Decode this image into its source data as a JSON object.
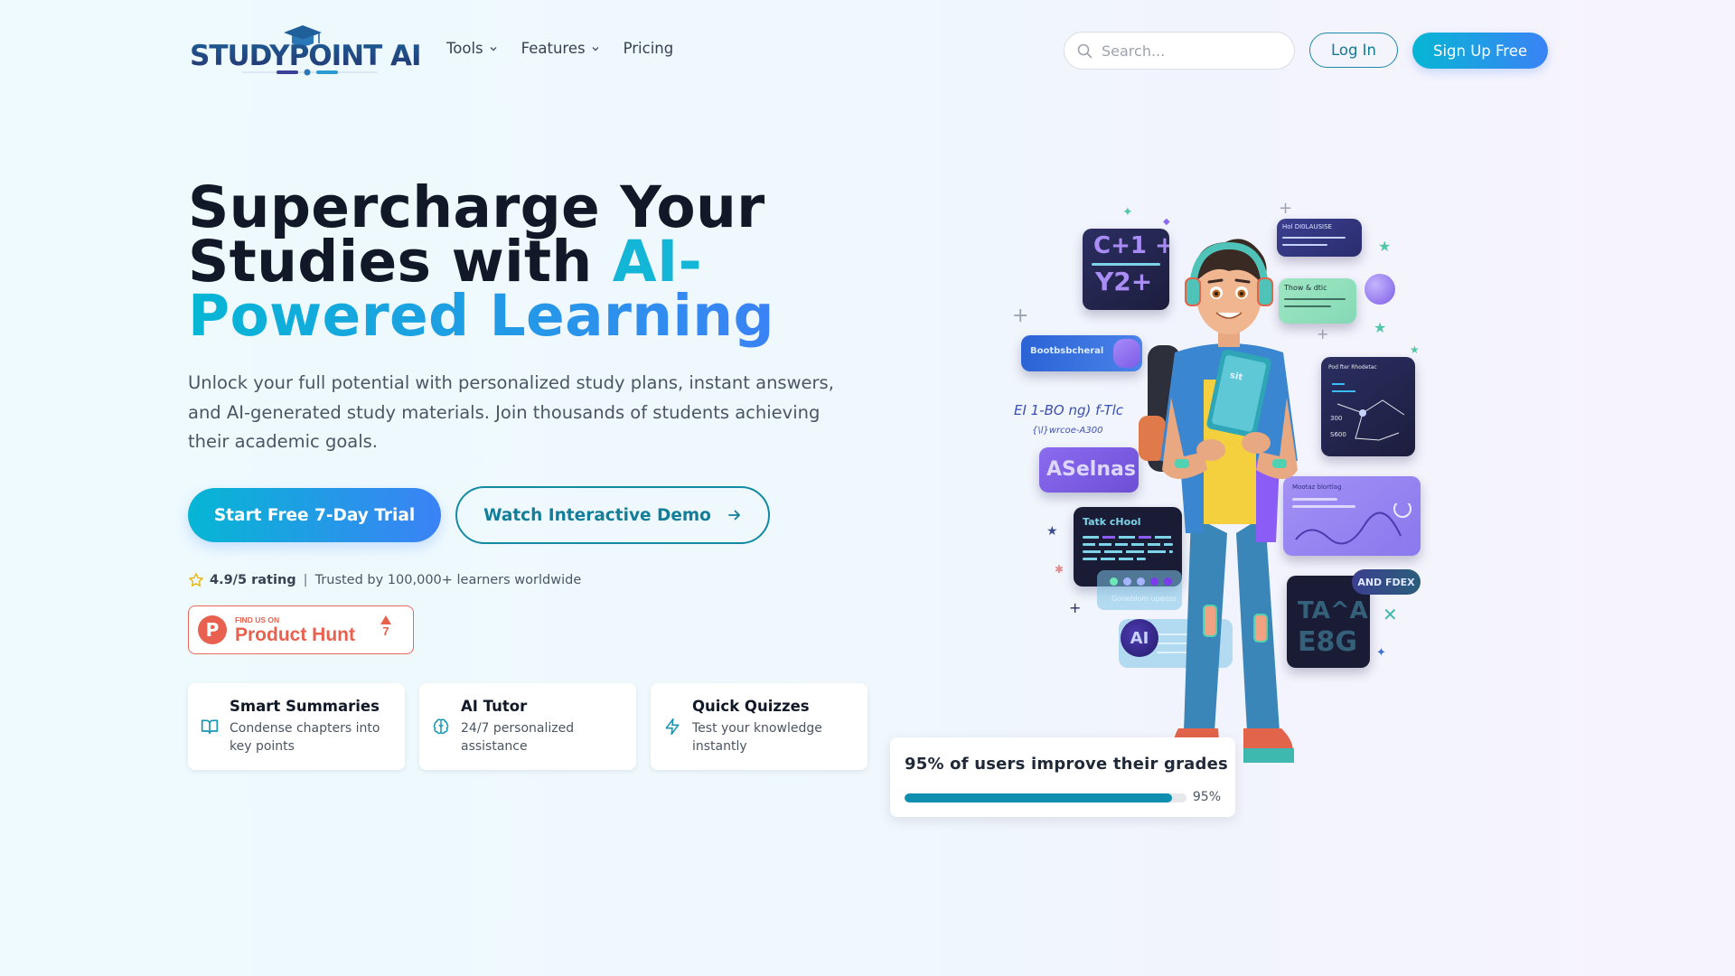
{
  "brand": {
    "name": "STUDYPOINT AI",
    "primary_gradient": [
      "#06b6d4",
      "#3b82f6"
    ],
    "text_dark": "#111827",
    "product_hunt_color": "#e8604f"
  },
  "header": {
    "logo_text": "STUDYPOINT AI",
    "nav": [
      {
        "label": "Tools",
        "has_dropdown": true
      },
      {
        "label": "Features",
        "has_dropdown": true
      },
      {
        "label": "Pricing",
        "has_dropdown": false
      }
    ],
    "search": {
      "placeholder": "Search...",
      "value": "",
      "icon": "search-icon"
    },
    "login_label": "Log In",
    "signup_label": "Sign Up Free"
  },
  "hero": {
    "headline_line1": "Supercharge Your",
    "headline_line2_plain": "Studies with ",
    "headline_line2_accent": "AI-",
    "headline_line3_accent": "Powered Learning",
    "lead": "Unlock your full potential with personalized study plans, instant answers, and AI-generated study materials. Join thousands of students achieving their academic goals.",
    "primary_cta": "Start Free 7-Day Trial",
    "secondary_cta": "Watch Interactive Demo",
    "secondary_cta_icon": "arrow-right-icon",
    "rating": {
      "icon": "star-icon",
      "value": "4.9/5 rating",
      "separator": "|",
      "trust_text": "Trusted by 100,000+ learners worldwide"
    },
    "product_hunt": {
      "small_label": "FIND US ON",
      "big_label": "Product Hunt",
      "logo_letter": "P",
      "upvotes": "7"
    }
  },
  "features": [
    {
      "icon": "book-open-icon",
      "title": "Smart Summaries",
      "description": "Condense chapters into key points"
    },
    {
      "icon": "brain-icon",
      "title": "AI Tutor",
      "description": "24/7 personalized assistance"
    },
    {
      "icon": "zap-icon",
      "title": "Quick Quizzes",
      "description": "Test your knowledge instantly"
    }
  ],
  "stats": {
    "title": "95% of users improve their grades",
    "progress_percent": 95,
    "progress_label": "95%"
  },
  "illustration": {
    "description": "3D student character with headphones holding a tablet, surrounded by floating study UI panels",
    "panel_labels": {
      "math_card": [
        "C+1 +",
        "Y2+"
      ],
      "speech_dark": "Hol DI0LAUSISE",
      "mint_card": "Thow & dtic",
      "blue_bubble": "Bootbsbcheral",
      "formula_text": "EI 1-BO ng) f-Tlc",
      "formula_sub": "{\\l}wrcoe-A300",
      "purple_bubble": "ASelnas",
      "graph_card": "Pod fter Rhodetac",
      "code_card": "Tatk cHool",
      "glass_label": "Goneblom upeoss",
      "lav_card": "Mootaz blortlag",
      "badge": "AND FDEX",
      "letters_card": [
        "TA^A",
        "E8G"
      ],
      "ai_badge": "AI"
    }
  }
}
